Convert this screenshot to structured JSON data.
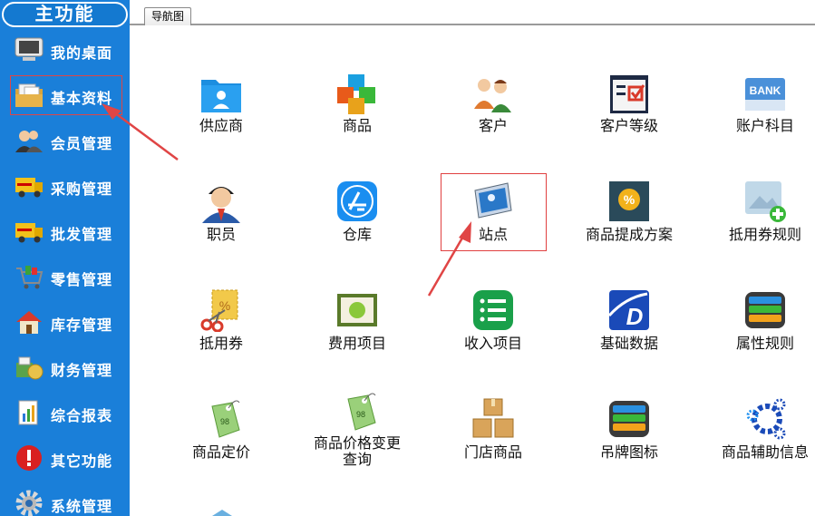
{
  "sidebar": {
    "title": "主功能",
    "items": [
      {
        "label": "我的桌面",
        "icon": "desktop-icon"
      },
      {
        "label": "基本资料",
        "icon": "folder-docs-icon"
      },
      {
        "label": "会员管理",
        "icon": "members-icon"
      },
      {
        "label": "采购管理",
        "icon": "truck-icon"
      },
      {
        "label": "批发管理",
        "icon": "truck-icon"
      },
      {
        "label": "零售管理",
        "icon": "cart-icon"
      },
      {
        "label": "库存管理",
        "icon": "house-icon"
      },
      {
        "label": "财务管理",
        "icon": "finance-icon"
      },
      {
        "label": "综合报表",
        "icon": "report-icon"
      },
      {
        "label": "其它功能",
        "icon": "exclamation-icon"
      },
      {
        "label": "系统管理",
        "icon": "gear-icon"
      }
    ]
  },
  "tabs": {
    "nav": "导航图"
  },
  "grid": {
    "items": [
      {
        "label": "供应商",
        "icon": "supplier-folder-icon"
      },
      {
        "label": "商品",
        "icon": "cubes-icon"
      },
      {
        "label": "客户",
        "icon": "customers-icon"
      },
      {
        "label": "客户等级",
        "icon": "checklist-icon"
      },
      {
        "label": "账户科目",
        "icon": "bank-icon"
      },
      {
        "label": "职员",
        "icon": "employee-icon"
      },
      {
        "label": "仓库",
        "icon": "appstore-icon"
      },
      {
        "label": "站点",
        "icon": "station-icon"
      },
      {
        "label": "商品提成方案",
        "icon": "commission-icon"
      },
      {
        "label": "抵用券规则",
        "icon": "image-plus-icon"
      },
      {
        "label": "抵用券",
        "icon": "coupon-scissors-icon"
      },
      {
        "label": "费用项目",
        "icon": "expense-icon"
      },
      {
        "label": "收入项目",
        "icon": "list-icon"
      },
      {
        "label": "基础数据",
        "icon": "d-logo-icon"
      },
      {
        "label": "属性规则",
        "icon": "stack-icon"
      },
      {
        "label": "商品定价",
        "icon": "price-tag-icon"
      },
      {
        "label": "商品价格变更\n查询",
        "icon": "price-tag-icon"
      },
      {
        "label": "门店商品",
        "icon": "boxes-icon"
      },
      {
        "label": "吊牌图标",
        "icon": "stack-icon"
      },
      {
        "label": "商品辅助信息",
        "icon": "gears-icon"
      }
    ]
  },
  "colors": {
    "sidebar": "#1a7fd9",
    "highlight": "#e04040"
  }
}
